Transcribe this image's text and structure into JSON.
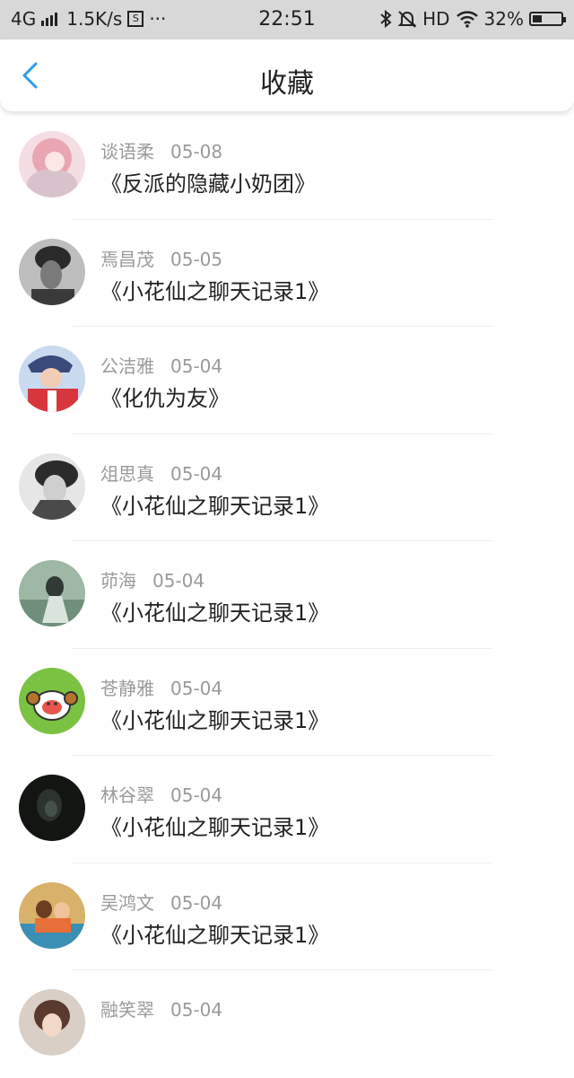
{
  "status_bar": {
    "network": "4G",
    "speed": "1.5K/s",
    "sim_icon_label": "S",
    "more": "···",
    "time": "22:51",
    "hd": "HD",
    "battery": "32%",
    "battery_level": 0.32,
    "icons": [
      "signal-icon",
      "sim-icon",
      "bluetooth-icon",
      "mute-icon",
      "wifi-icon",
      "battery-icon"
    ]
  },
  "header": {
    "title": "收藏",
    "back_icon": "chevron-left-icon",
    "accent_color": "#2c9cf0"
  },
  "items": [
    {
      "name": "谈语柔",
      "date": "05-08",
      "title": "《反派的隐藏小奶团》"
    },
    {
      "name": "焉昌茂",
      "date": "05-05",
      "title": "《小花仙之聊天记录1》"
    },
    {
      "name": "公洁雅",
      "date": "05-04",
      "title": "《化仇为友》"
    },
    {
      "name": "俎思真",
      "date": "05-04",
      "title": "《小花仙之聊天记录1》"
    },
    {
      "name": "茆海",
      "date": "05-04",
      "title": "《小花仙之聊天记录1》"
    },
    {
      "name": "苍静雅",
      "date": "05-04",
      "title": "《小花仙之聊天记录1》"
    },
    {
      "name": "林谷翠",
      "date": "05-04",
      "title": "《小花仙之聊天记录1》"
    },
    {
      "name": "吴鸿文",
      "date": "05-04",
      "title": "《小花仙之聊天记录1》"
    },
    {
      "name": "融笑翠",
      "date": "05-04",
      "title": ""
    }
  ]
}
